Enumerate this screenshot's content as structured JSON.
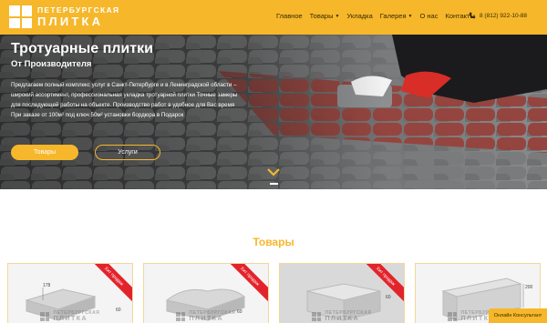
{
  "logo": {
    "top": "ПЕТЕРБУРГСКАЯ",
    "bottom": "ПЛИТКА"
  },
  "nav": {
    "items": [
      {
        "label": "Главное",
        "dropdown": false
      },
      {
        "label": "Товары",
        "dropdown": true
      },
      {
        "label": "Укладка",
        "dropdown": false
      },
      {
        "label": "Галерея",
        "dropdown": true
      },
      {
        "label": "О нас",
        "dropdown": false
      },
      {
        "label": "Контакты",
        "dropdown": false
      }
    ],
    "phone": "8 (812) 922-10-88"
  },
  "hero": {
    "title": "Тротуарные плитки",
    "subtitle": "От Производителя",
    "lines": [
      "Предлагаем полный комплекс услуг в Санкт-Петербурге и в Ленинградской области –",
      "широкий ассортимент, профессиональная укладка тротуарной плитки Точные замеры",
      "для последующей работы на объекте. Производство работ в удобное для Вас время",
      "При заказе от 100м² под ключ 50м² установки бордюра в Подарок"
    ],
    "button_goods": "Товары",
    "button_services": "Услуги"
  },
  "goods": {
    "title": "Товары",
    "cards": [
      {
        "badge": "Хит продаж",
        "dims": [
          "178",
          "60"
        ]
      },
      {
        "badge": "Хит продаж",
        "dims": [
          "60"
        ]
      },
      {
        "badge": "Хит продаж",
        "dims": [
          "60"
        ]
      },
      {
        "badge": "",
        "dims": [
          "200"
        ]
      }
    ],
    "watermark_top": "ПЕТЕРБУРГСКАЯ",
    "watermark_bottom": "ПЛИТКА"
  },
  "consultant": "Онлайн Консультант",
  "colors": {
    "accent": "#f6b72b",
    "ribbon": "#e3232b"
  }
}
